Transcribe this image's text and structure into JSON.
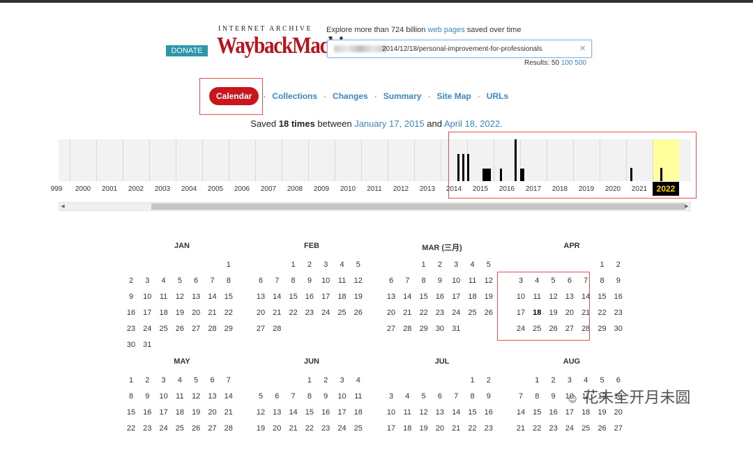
{
  "header": {
    "donate": "DONATE",
    "logo_top": "INTERNET ARCHIVE",
    "logo_main_a": "WaybackMac",
    "logo_main_b": "hine",
    "explore_prefix": "Explore more than 724 billion ",
    "explore_link": "web pages",
    "explore_suffix": " saved over time",
    "search_value": "2014/12/18/personal-improvement-for-professionals",
    "clear_icon": "×",
    "results_prefix": "Results: 50 ",
    "results_100": "100",
    "results_500": "500"
  },
  "nav": {
    "calendar": "Calendar",
    "items": [
      "Collections",
      "Changes",
      "Summary",
      "Site Map",
      "URLs"
    ],
    "separator": "·"
  },
  "saved": {
    "prefix": "Saved ",
    "count": "18 times",
    "between": " between ",
    "start": "January 17, 2015",
    "and": " and ",
    "end": "April 18, 2022."
  },
  "histogram": {
    "years": [
      "1999",
      "2000",
      "2001",
      "2002",
      "2003",
      "2004",
      "2005",
      "2006",
      "2007",
      "2008",
      "2009",
      "2010",
      "2011",
      "2012",
      "2013",
      "2014",
      "2015",
      "2016",
      "2017",
      "2018",
      "2019",
      "2020",
      "2021",
      "2022"
    ],
    "first_label": "999",
    "selected_year": "2022",
    "captures": {
      "2015": [
        0.65,
        0.65,
        0.65
      ],
      "2016": [
        0.3,
        0.3,
        0.3,
        0.3,
        0.3
      ],
      "2017": [
        1.0,
        0.3,
        0.3
      ],
      "2021": [
        0.32
      ],
      "2022": [
        0.32
      ]
    }
  },
  "scrollbar": {
    "left_arrow": "◀",
    "right_arrow": "▶"
  },
  "calendar": {
    "months": [
      {
        "name": "JAN",
        "start": 6,
        "days": 31
      },
      {
        "name": "FEB",
        "start": 2,
        "days": 28
      },
      {
        "name": "MAR (三月)",
        "start": 2,
        "days": 31
      },
      {
        "name": "APR",
        "start": 5,
        "days": 30,
        "selected": [
          18
        ]
      },
      {
        "name": "MAY",
        "start": 0,
        "days": 31
      },
      {
        "name": "JUN",
        "start": 3,
        "days": 30
      },
      {
        "name": "JUL",
        "start": 5,
        "days": 31
      },
      {
        "name": "AUG",
        "start": 1,
        "days": 31
      }
    ]
  },
  "watermark": "花未全开月未圆",
  "colors": {
    "accent": "#c8161d",
    "link": "#3a87c8",
    "donate": "#2b97a9",
    "highlight": "#ffff9e"
  }
}
